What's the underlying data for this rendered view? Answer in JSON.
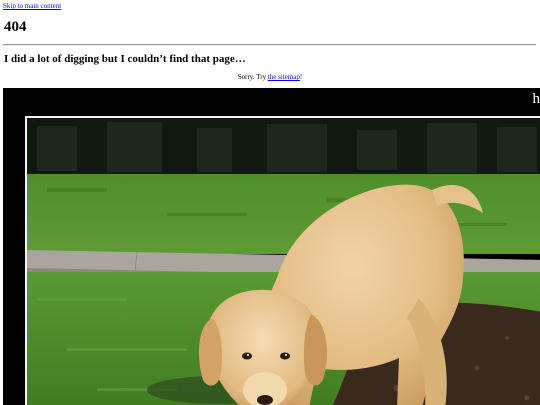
{
  "skip_link": "Skip to main content",
  "heading": "404",
  "subheading": "I did a lot of digging but I couldn’t find that page…",
  "sorry": {
    "prefix": "Sorry. Try ",
    "link": "the sitemap",
    "suffix": "!"
  },
  "photo": {
    "overlay_text": "h"
  },
  "colors": {
    "link": "#0000ee",
    "photo_frame": "#000000",
    "grass": "#4f8a2c",
    "path": "#a9a49c",
    "dog": "#e7c48f"
  }
}
